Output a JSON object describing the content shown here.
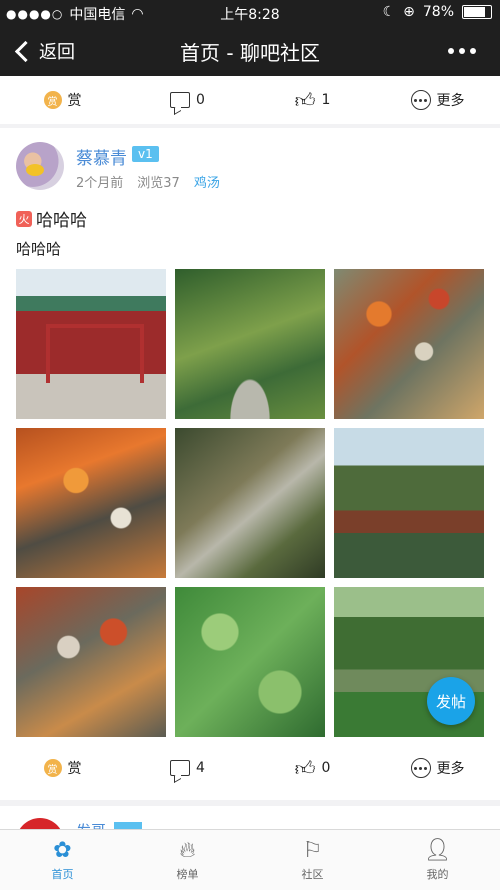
{
  "status_bar": {
    "carrier": "中国电信",
    "time": "上午8:28",
    "battery": "78%",
    "battery_level": 0.78
  },
  "nav": {
    "back_label": "返回",
    "title": "首页 - 聊吧社区"
  },
  "prev_post_actions": {
    "reward": "赏",
    "reward_coin": "赏",
    "comments": "0",
    "likes": "1",
    "more": "更多"
  },
  "post": {
    "username": "蔡慕青",
    "level": "v1",
    "time_ago": "2个月前",
    "views": "浏览37",
    "tag": "鸡汤",
    "hot_badge": "火",
    "title": "哈哈哈",
    "content": "哈哈哈",
    "images": [
      "temple-gate",
      "bamboo-path",
      "koi-fish",
      "koi-fish",
      "stone-steps",
      "pavilion-lake",
      "koi-fish",
      "lotus-leaves",
      "park-crowd"
    ],
    "actions": {
      "reward": "赏",
      "reward_coin": "赏",
      "comments": "4",
      "likes": "0",
      "more": "更多"
    }
  },
  "next_post": {
    "username": "发哥"
  },
  "fab_label": "发帖",
  "tabs": [
    {
      "label": "首页",
      "icon": "flower-icon",
      "active": true
    },
    {
      "label": "榜单",
      "icon": "fire-icon",
      "active": false
    },
    {
      "label": "社区",
      "icon": "signpost-icon",
      "active": false
    },
    {
      "label": "我的",
      "icon": "user-icon",
      "active": false
    }
  ],
  "colors": {
    "accent": "#1aa3e8",
    "link": "#4a8bd6",
    "tag": "#3aa4e6",
    "bar": "#1f1f1f"
  }
}
